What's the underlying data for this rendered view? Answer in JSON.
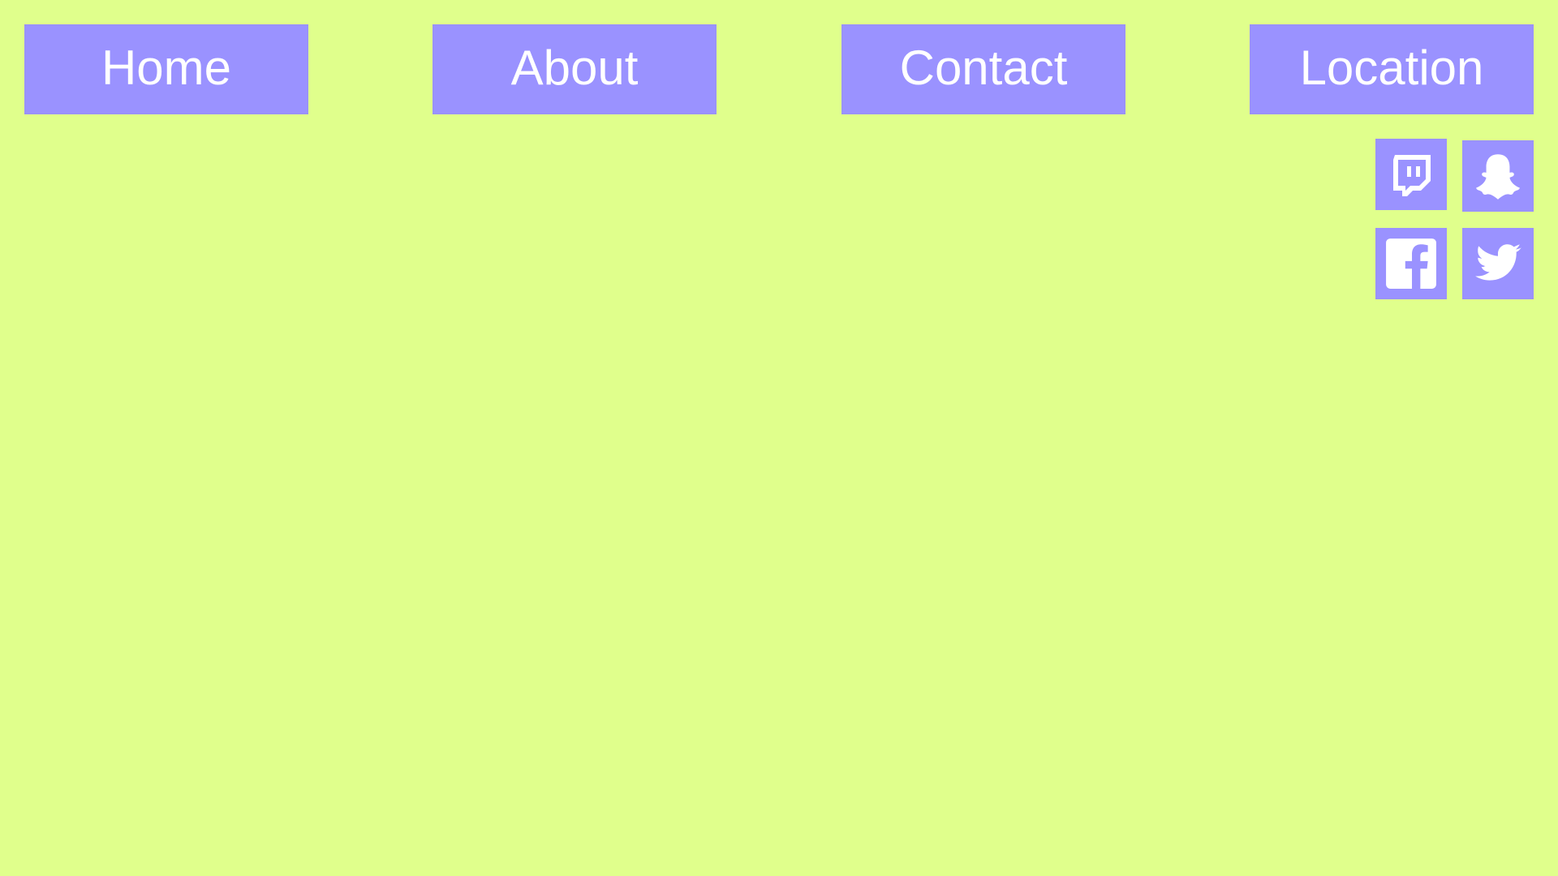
{
  "colors": {
    "background": "#e0ff8c",
    "button": "#9a92ff",
    "text": "#ffffff"
  },
  "nav": {
    "home_label": "Home",
    "about_label": "About",
    "contact_label": "Contact",
    "location_label": "Location"
  },
  "social": {
    "icons": [
      "twitch-icon",
      "snapchat-icon",
      "facebook-icon",
      "twitter-icon"
    ]
  }
}
